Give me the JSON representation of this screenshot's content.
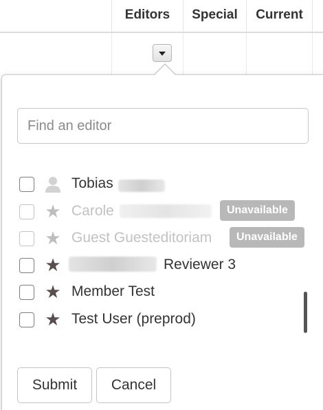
{
  "table": {
    "headers": [
      "Editors",
      "Special",
      "Current"
    ]
  },
  "popover": {
    "search": {
      "placeholder": "Find an editor",
      "value": ""
    },
    "editors": [
      {
        "name": "Tobias",
        "icon": "person-icon",
        "status": "",
        "checked": false,
        "disabled": false
      },
      {
        "name": "Carole",
        "icon": "star-icon",
        "status": "Unavailable",
        "checked": false,
        "disabled": true
      },
      {
        "name": "Guest Guesteditoriam",
        "icon": "star-icon",
        "status": "Unavailable",
        "checked": false,
        "disabled": true
      },
      {
        "name": "Reviewer 3",
        "icon": "star-icon",
        "status": "",
        "checked": false,
        "disabled": false
      },
      {
        "name": "Member Test",
        "icon": "star-icon",
        "status": "",
        "checked": false,
        "disabled": false
      },
      {
        "name": "Test User (preprod)",
        "icon": "star-icon",
        "status": "",
        "checked": false,
        "disabled": false
      }
    ],
    "buttons": {
      "submit": "Submit",
      "cancel": "Cancel"
    }
  },
  "colors": {
    "badge": "#b8b8b8",
    "icon": "#5a4d4d",
    "disabled_text": "#c2c2c2"
  }
}
